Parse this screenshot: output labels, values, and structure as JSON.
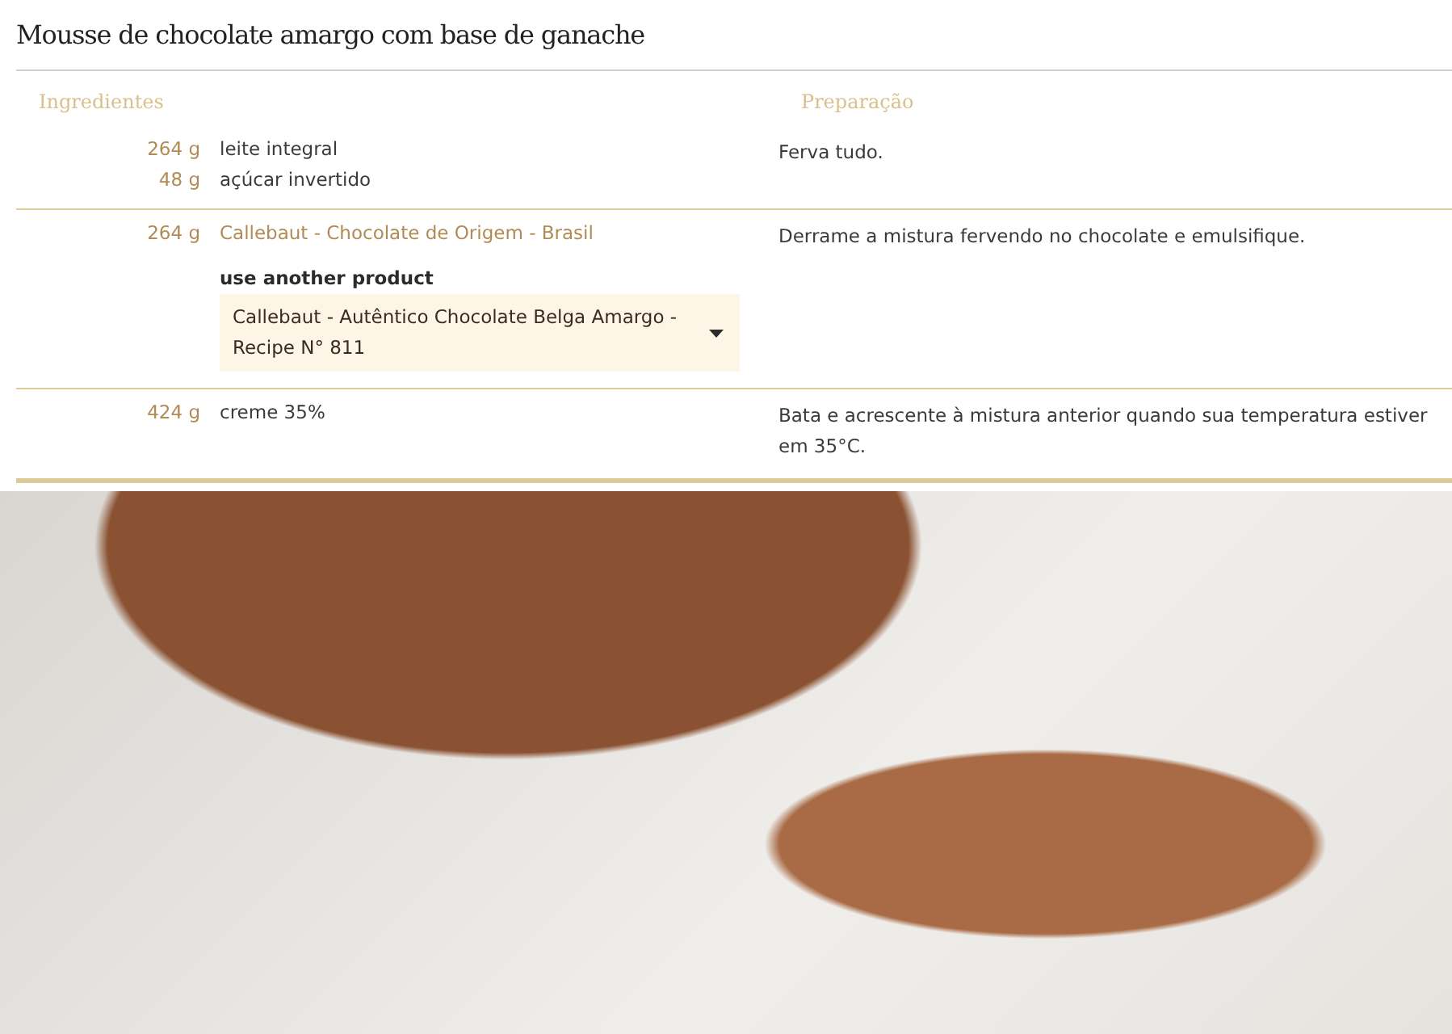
{
  "title": "Mousse de chocolate amargo com base de ganache",
  "headers": {
    "ingredients": "Ingredientes",
    "preparation": "Preparação"
  },
  "steps": [
    {
      "ingredients": [
        {
          "kind": "plain",
          "qty": "264 g",
          "name": "leite integral"
        },
        {
          "kind": "plain",
          "qty": "48 g",
          "name": "açúcar invertido"
        }
      ],
      "instruction": "Ferva tudo."
    },
    {
      "ingredients": [
        {
          "kind": "product",
          "qty": "264 g",
          "name": "Callebaut - Chocolate de Origem - Brasil",
          "alternative": {
            "label": "use another product",
            "value": "Callebaut - Autêntico Chocolate Belga Amargo - Recipe N° 811"
          }
        }
      ],
      "instruction": "Derrame a mistura fervendo no chocolate e emulsifique."
    },
    {
      "ingredients": [
        {
          "kind": "plain",
          "qty": "424 g",
          "name": "creme 35%"
        }
      ],
      "instruction": "Bata e acrescente à mistura anterior quando sua temperatura estiver em 35°C."
    }
  ]
}
